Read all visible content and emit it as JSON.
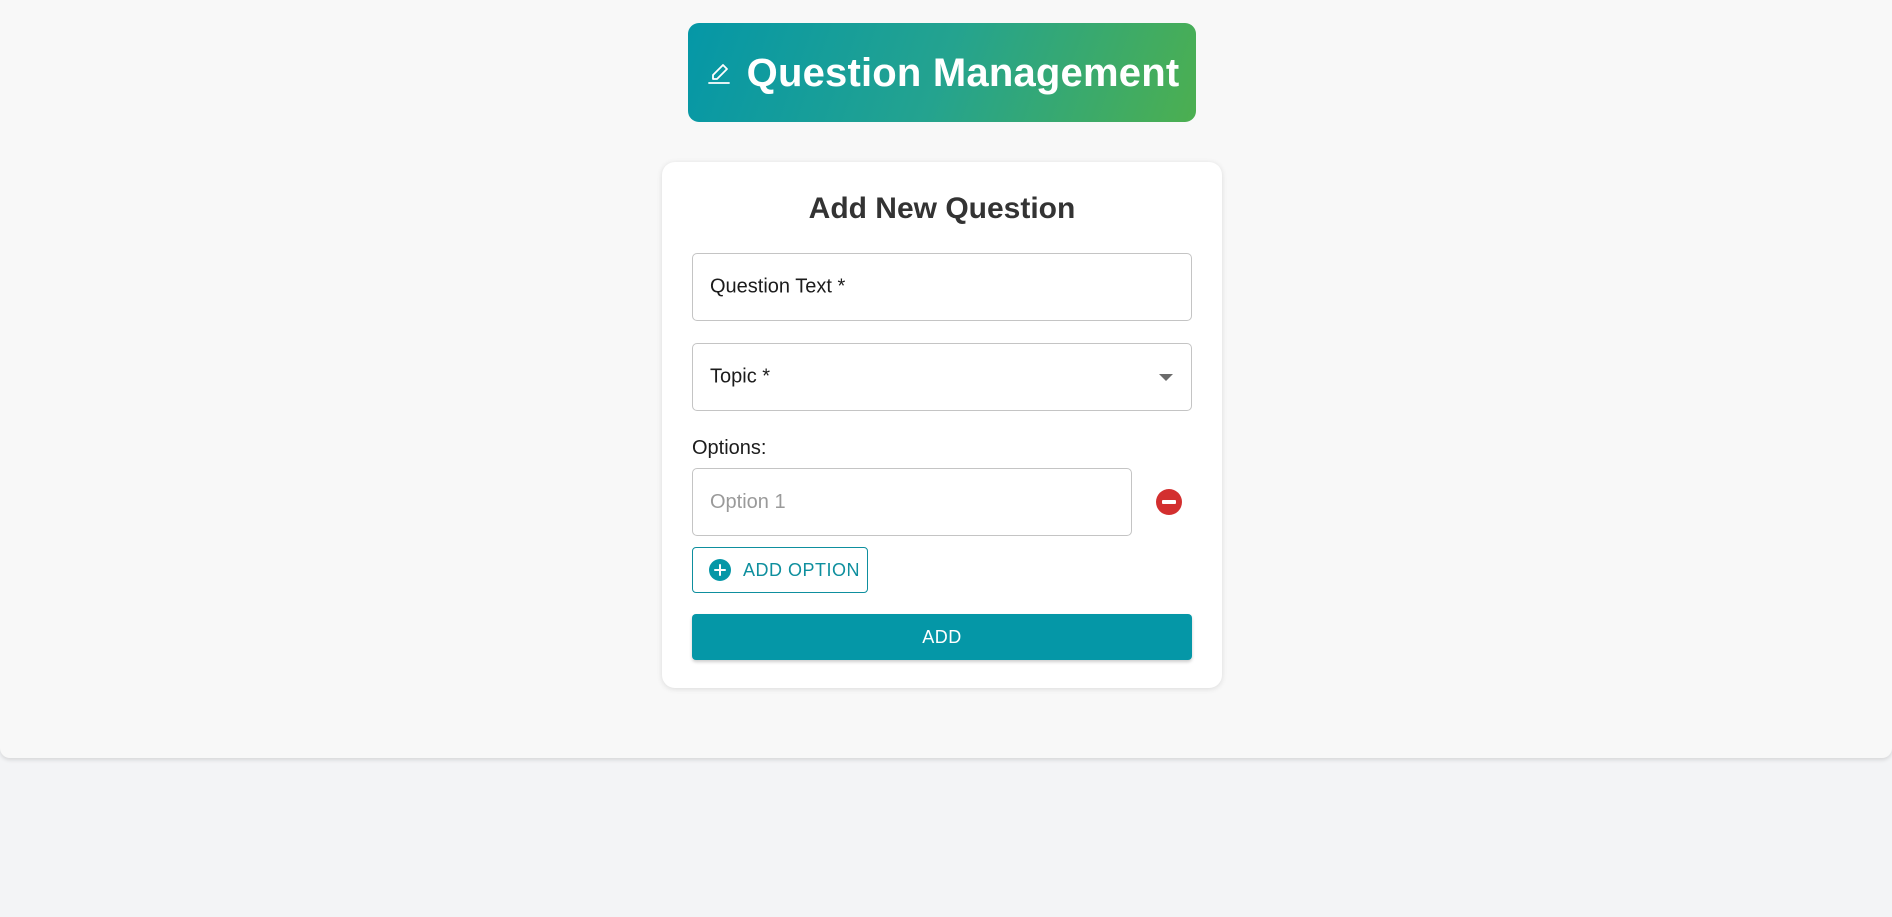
{
  "header": {
    "title": "Question Management",
    "icon": "pencil-icon",
    "gradient_start": "#0597a7",
    "gradient_end": "#4caf50"
  },
  "form": {
    "title": "Add New Question",
    "question_text_label": "Question Text *",
    "topic_label": "Topic *",
    "options_label": "Options:",
    "options": [
      {
        "value": "",
        "placeholder": "Option 1"
      }
    ],
    "add_option_label": "ADD OPTION",
    "submit_label": "ADD"
  },
  "colors": {
    "accent": "#0597a7",
    "danger": "#d32f2f",
    "background": "#f8f8f8"
  }
}
